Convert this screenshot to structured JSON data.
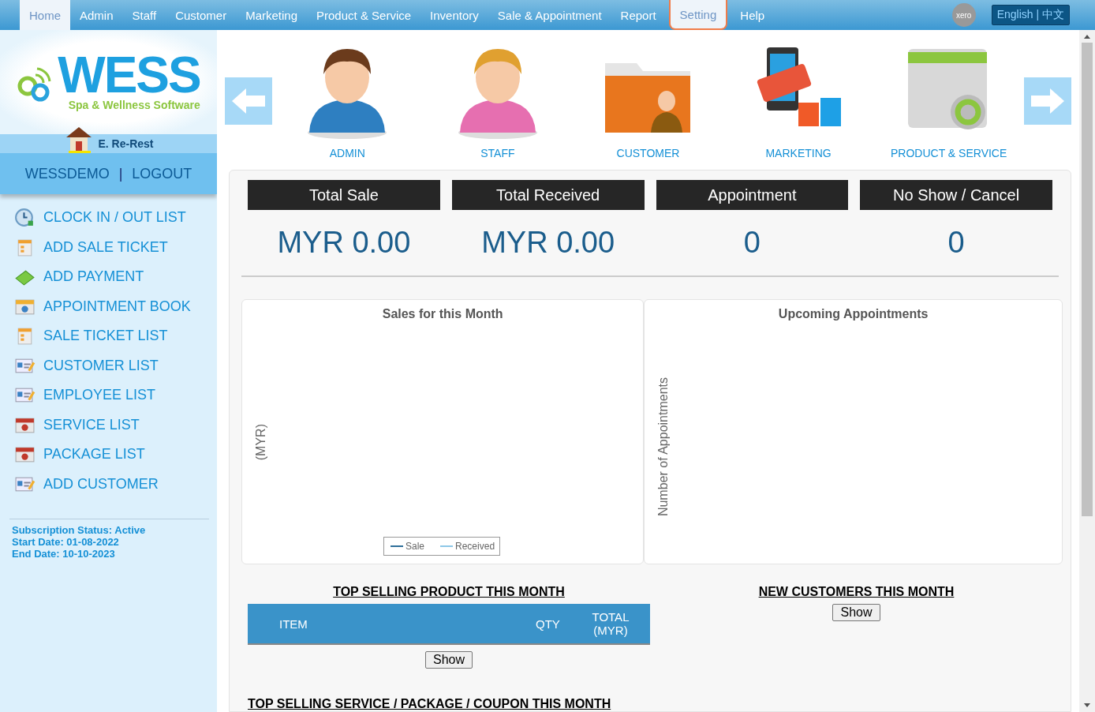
{
  "nav": {
    "items": [
      {
        "label": "Home",
        "selected": true,
        "focused": false
      },
      {
        "label": "Admin",
        "selected": false,
        "focused": false
      },
      {
        "label": "Staff",
        "selected": false,
        "focused": false
      },
      {
        "label": "Customer",
        "selected": false,
        "focused": false
      },
      {
        "label": "Marketing",
        "selected": false,
        "focused": false
      },
      {
        "label": "Product & Service",
        "selected": false,
        "focused": false
      },
      {
        "label": "Inventory",
        "selected": false,
        "focused": false
      },
      {
        "label": "Sale & Appointment",
        "selected": false,
        "focused": false
      },
      {
        "label": "Report",
        "selected": false,
        "focused": false
      },
      {
        "label": "Setting",
        "selected": true,
        "focused": true
      },
      {
        "label": "Help",
        "selected": false,
        "focused": false
      }
    ],
    "xero": "xero",
    "language": "English | 中文"
  },
  "sidebar": {
    "logo": {
      "title": "WESS",
      "subtitle": "Spa & Wellness Software"
    },
    "outlet": "E. Re-Rest",
    "user": "WESSDEMO",
    "separator": "|",
    "logout": "LOGOUT",
    "menu": [
      "CLOCK IN / OUT LIST",
      "ADD SALE TICKET",
      "ADD PAYMENT",
      "APPOINTMENT BOOK",
      "SALE TICKET LIST",
      "CUSTOMER LIST",
      "EMPLOYEE LIST",
      "SERVICE LIST",
      "PACKAGE LIST",
      "ADD CUSTOMER"
    ],
    "subscription": [
      "Subscription Status: Active",
      "Start Date: 01-08-2022",
      "End Date: 10-10-2023"
    ]
  },
  "shortcuts": [
    "ADMIN",
    "STAFF",
    "CUSTOMER",
    "MARKETING",
    "PRODUCT & SERVICE"
  ],
  "stats": [
    {
      "label": "Total Sale",
      "value": "MYR 0.00"
    },
    {
      "label": "Total Received",
      "value": "MYR 0.00"
    },
    {
      "label": "Appointment",
      "value": "0"
    },
    {
      "label": "No Show / Cancel",
      "value": "0"
    }
  ],
  "sales_chart": {
    "title": "Sales for this Month",
    "ylabel": "(MYR)",
    "legend": [
      {
        "name": "Sale",
        "color": "#2f6f9a"
      },
      {
        "name": "Received",
        "color": "#8ec8e8"
      }
    ]
  },
  "appointments_chart": {
    "title": "Upcoming Appointments",
    "ylabel": "Number of Appointments"
  },
  "top_products": {
    "title": "TOP SELLING PRODUCT THIS MONTH",
    "columns": [
      "ITEM",
      "QTY",
      "TOTAL (MYR)"
    ],
    "button": "Show"
  },
  "new_customers": {
    "title": "NEW CUSTOMERS THIS MONTH",
    "button": "Show"
  },
  "top_services": {
    "title": "TOP SELLING SERVICE / PACKAGE / COUPON THIS MONTH"
  }
}
